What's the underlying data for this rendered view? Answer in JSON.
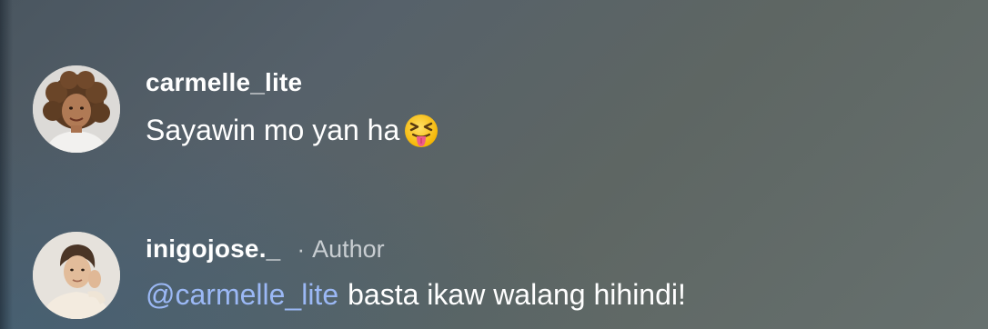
{
  "comments": [
    {
      "username": "carmelle_lite",
      "text": "Sayawin mo yan ha",
      "emoji": "squinting-face-with-tongue-emoji"
    },
    {
      "username": "inigojose._",
      "separator": "·",
      "badge": "Author",
      "mention": "@carmelle_lite",
      "text": "basta ikaw walang hihindi!"
    }
  ],
  "icons": {
    "avatar_1": "avatar-carmelle",
    "avatar_2": "avatar-inigojose"
  },
  "colors": {
    "mention": "#9bb8f5",
    "meta": "#c9ced2"
  }
}
